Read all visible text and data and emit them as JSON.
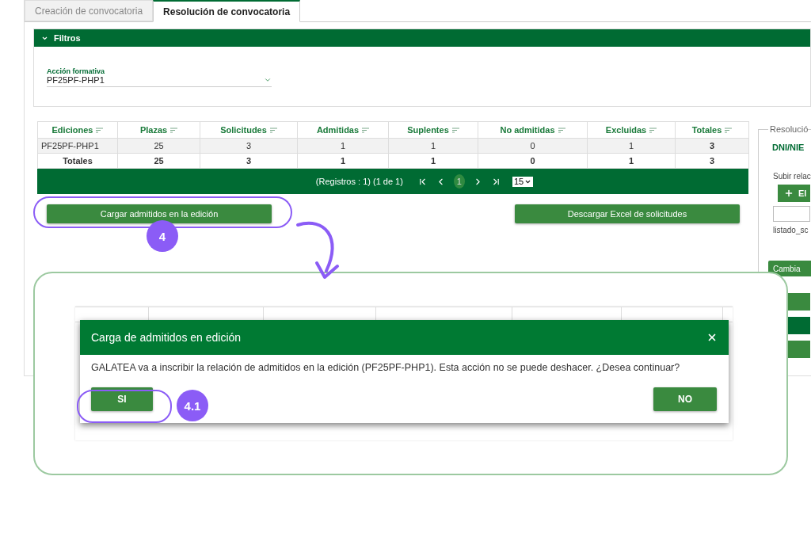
{
  "tabs": [
    {
      "label": "Creación de convocatoria",
      "selected": false
    },
    {
      "label": "Resolución de convocatoria",
      "selected": true
    }
  ],
  "filters": {
    "title": "Filtros",
    "expanded": true,
    "field": {
      "label": "Acción formativa",
      "value": "PF25PF-PHP1"
    }
  },
  "table": {
    "columns": [
      "Ediciones",
      "Plazas",
      "Solicitudes",
      "Admitidas",
      "Suplentes",
      "No admitidas",
      "Excluidas",
      "Totales"
    ],
    "rows": [
      {
        "kind": "data",
        "cells": [
          "PF25PF-PHP1",
          "25",
          "3",
          "1",
          "1",
          "0",
          "1",
          "3"
        ]
      },
      {
        "kind": "total",
        "cells": [
          "Totales",
          "25",
          "3",
          "1",
          "1",
          "0",
          "1",
          "3"
        ]
      }
    ]
  },
  "pagination": {
    "records": "(Registros : 1) (1 de 1)",
    "page": "1",
    "page_size": "15"
  },
  "buttons": [
    "Cargar admitidos en la edición",
    "Descargar Excel de solicitudes"
  ],
  "side_panel": {
    "legend": "Resolució",
    "label": "DNI/NIE",
    "upload_label": "Subir relac",
    "add_button": "El",
    "file_name": "listado_sc",
    "change_button": "Cambia"
  },
  "dialog": {
    "title": "Carga de admitidos en edición",
    "message": "GALATEA va a inscribir la relación de admitidos en la edición (PF25PF-PHP1). Esta acción no se puede deshacer. ¿Desea continuar?",
    "buttons": [
      "SI",
      "NO"
    ]
  },
  "annotations": [
    {
      "label": "4"
    },
    {
      "label": "4.1"
    }
  ]
}
